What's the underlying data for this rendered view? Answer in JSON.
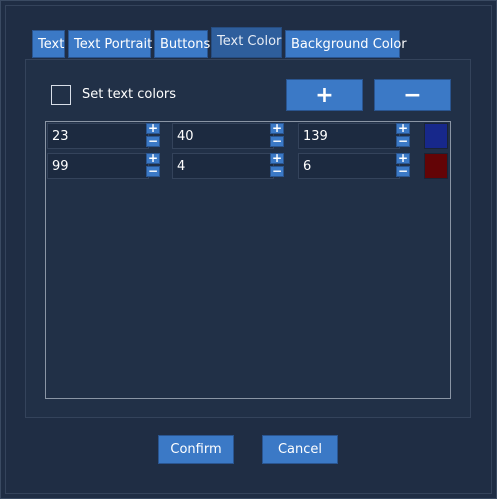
{
  "tabs": [
    {
      "label": "Text"
    },
    {
      "label": "Text Portrait"
    },
    {
      "label": "Buttons"
    },
    {
      "label": "Text Color"
    },
    {
      "label": "Background Color"
    }
  ],
  "active_tab": "Text Color",
  "set_text_colors": {
    "label": "Set text colors",
    "checked": false
  },
  "toolbar": {
    "add_label": "+",
    "remove_label": "−"
  },
  "colors": [
    {
      "r": "23",
      "g": "40",
      "b": "139",
      "swatch": "#17288b"
    },
    {
      "r": "99",
      "g": "4",
      "b": "6",
      "swatch": "#630406"
    }
  ],
  "spin_up": "+",
  "spin_down": "−",
  "footer": {
    "confirm_label": "Confirm",
    "cancel_label": "Cancel"
  },
  "accent_color": "#3b79c6"
}
